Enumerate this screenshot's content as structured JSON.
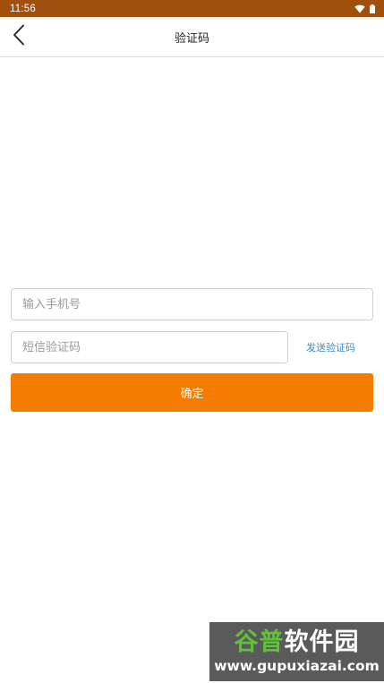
{
  "status_bar": {
    "time": "11:56",
    "background": "#a0500a",
    "icons": [
      "wifi-icon",
      "battery-icon"
    ]
  },
  "app_bar": {
    "title": "验证码",
    "back_icon": "chevron-left-icon"
  },
  "form": {
    "phone_placeholder": "输入手机号",
    "code_placeholder": "短信验证码",
    "send_code_label": "发送验证码",
    "confirm_label": "确定",
    "accent_color": "#f47c00",
    "link_color": "#3a8fd0"
  },
  "watermark": {
    "brand_part1": "谷普",
    "brand_part2": "软件园",
    "url": "www.gupuxiazai.com"
  }
}
